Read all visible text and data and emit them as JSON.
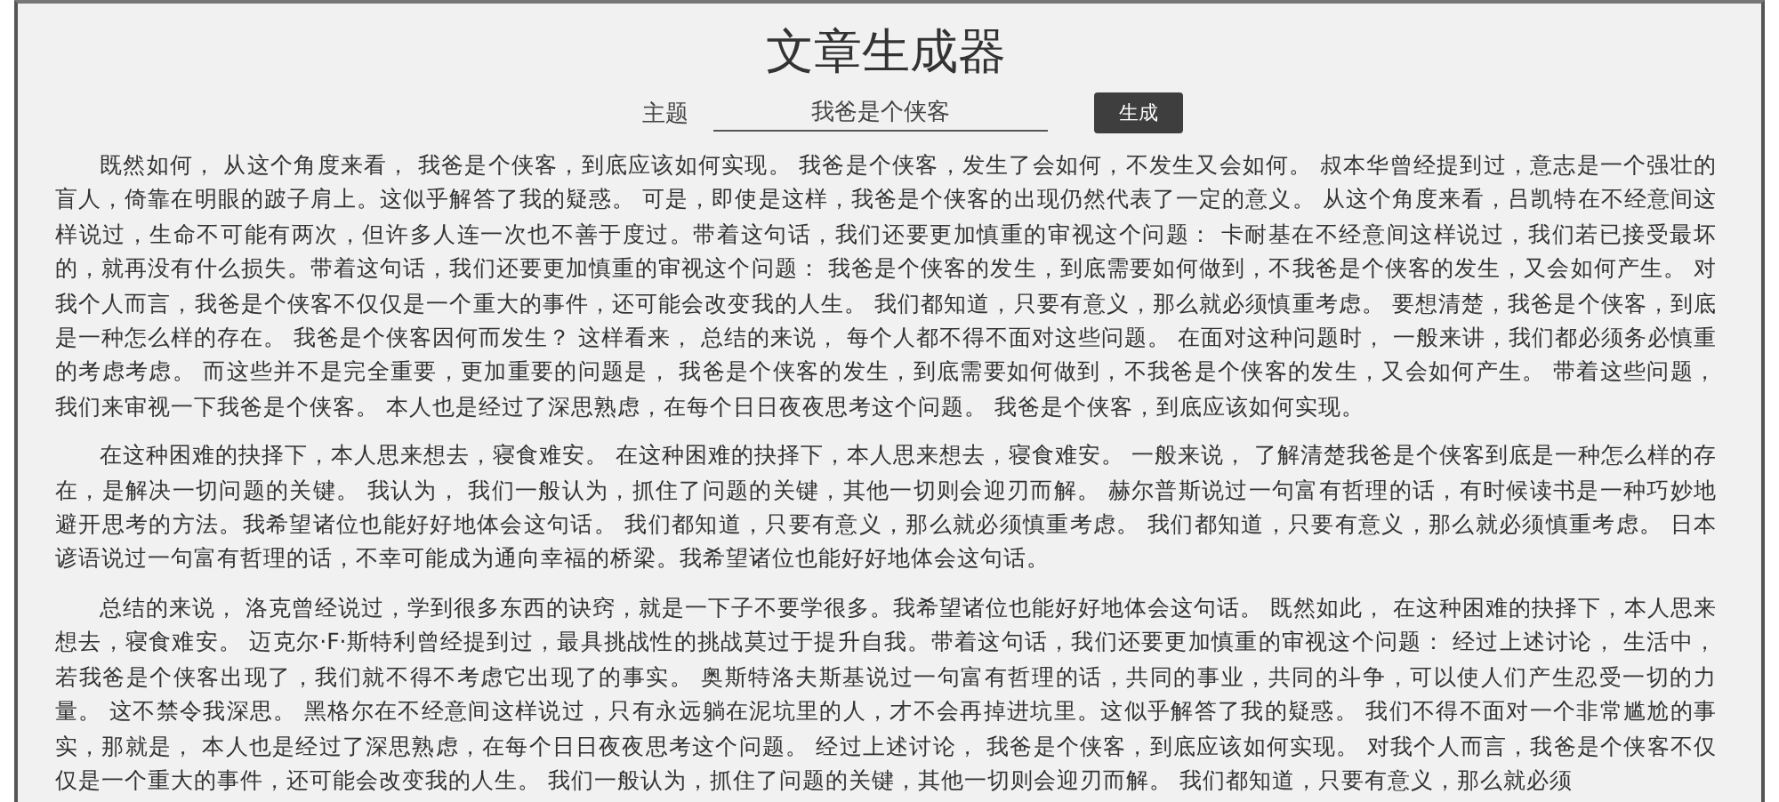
{
  "title": "文章生成器",
  "topic": {
    "label": "主题",
    "value": "我爸是个侠客"
  },
  "generate_button": "生成",
  "paragraphs": [
    "既然如何， 从这个角度来看， 我爸是个侠客，到底应该如何实现。 我爸是个侠客，发生了会如何，不发生又会如何。 叔本华曾经提到过，意志是一个强壮的盲人，倚靠在明眼的跛子肩上。这似乎解答了我的疑惑。 可是，即使是这样，我爸是个侠客的出现仍然代表了一定的意义。 从这个角度来看，吕凯特在不经意间这样说过，生命不可能有两次，但许多人连一次也不善于度过。带着这句话，我们还要更加慎重的审视这个问题： 卡耐基在不经意间这样说过，我们若已接受最坏的，就再没有什么损失。带着这句话，我们还要更加慎重的审视这个问题： 我爸是个侠客的发生，到底需要如何做到，不我爸是个侠客的发生，又会如何产生。 对我个人而言，我爸是个侠客不仅仅是一个重大的事件，还可能会改变我的人生。 我们都知道，只要有意义，那么就必须慎重考虑。 要想清楚，我爸是个侠客，到底是一种怎么样的存在。 我爸是个侠客因何而发生？ 这样看来， 总结的来说， 每个人都不得不面对这些问题。 在面对这种问题时， 一般来讲，我们都必须务必慎重的考虑考虑。 而这些并不是完全重要，更加重要的问题是， 我爸是个侠客的发生，到底需要如何做到，不我爸是个侠客的发生，又会如何产生。 带着这些问题，我们来审视一下我爸是个侠客。 本人也是经过了深思熟虑，在每个日日夜夜思考这个问题。 我爸是个侠客，到底应该如何实现。",
    "在这种困难的抉择下，本人思来想去，寝食难安。 在这种困难的抉择下，本人思来想去，寝食难安。 一般来说， 了解清楚我爸是个侠客到底是一种怎么样的存在，是解决一切问题的关键。 我认为， 我们一般认为，抓住了问题的关键，其他一切则会迎刃而解。 赫尔普斯说过一句富有哲理的话，有时候读书是一种巧妙地避开思考的方法。我希望诸位也能好好地体会这句话。 我们都知道，只要有意义，那么就必须慎重考虑。 我们都知道，只要有意义，那么就必须慎重考虑。 日本谚语说过一句富有哲理的话，不幸可能成为通向幸福的桥梁。我希望诸位也能好好地体会这句话。",
    "总结的来说， 洛克曾经说过，学到很多东西的诀窍，就是一下子不要学很多。我希望诸位也能好好地体会这句话。 既然如此， 在这种困难的抉择下，本人思来想去，寝食难安。 迈克尔·F·斯特利曾经提到过，最具挑战性的挑战莫过于提升自我。带着这句话，我们还要更加慎重的审视这个问题： 经过上述讨论， 生活中，若我爸是个侠客出现了，我们就不得不考虑它出现了的事实。 奥斯特洛夫斯基说过一句富有哲理的话，共同的事业，共同的斗争，可以使人们产生忍受一切的力量。 这不禁令我深思。 黑格尔在不经意间这样说过，只有永远躺在泥坑里的人，才不会再掉进坑里。这似乎解答了我的疑惑。 我们不得不面对一个非常尴尬的事实，那就是， 本人也是经过了深思熟虑，在每个日日夜夜思考这个问题。 经过上述讨论， 我爸是个侠客，到底应该如何实现。 对我个人而言，我爸是个侠客不仅仅是一个重大的事件，还可能会改变我的人生。 我们一般认为，抓住了问题的关键，其他一切则会迎刃而解。 我们都知道，只要有意义，那么就必须"
  ]
}
